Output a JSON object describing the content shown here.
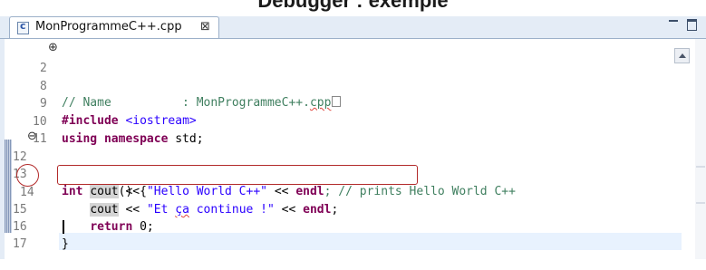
{
  "page": {
    "heading": "Debugger : exemple"
  },
  "tab": {
    "title": "MonProgrammeC++.cpp",
    "close_label": "⊠"
  },
  "window_controls": {
    "minimize": "minimize-icon",
    "maximize": "maximize-icon"
  },
  "editor": {
    "lines": [
      {
        "number": "2",
        "text": "// Name          : MonProgrammeC++.cpp"
      },
      {
        "number": "8",
        "text": ""
      },
      {
        "number": "9",
        "text": "#include <iostream>"
      },
      {
        "number": "10",
        "text": "using namespace std;"
      },
      {
        "number": "11",
        "text": ""
      },
      {
        "number": "12",
        "text": "int main() {"
      },
      {
        "number": "13",
        "text": "    cout << \"Hello World C++\" << endl; // prints Hello World C++"
      },
      {
        "number": "14",
        "text": "    cout << \"Et ça continue !\" << endl;"
      },
      {
        "number": "15",
        "text": "    return 0;"
      },
      {
        "number": "16",
        "text": "}"
      },
      {
        "number": "17",
        "text": ""
      }
    ],
    "tokens": {
      "l2_comment": "// Name          : MonProgrammeC++.",
      "l2_cpp": "cpp",
      "l9_kw": "#include",
      "l9_rest": " <iostream>",
      "l10_kw": "using namespace",
      "l10_rest": " std;",
      "l12_kw": "int",
      "l12_main": " main",
      "l12_rest": "() {",
      "indent": "    ",
      "cout": "cout",
      "shift": " << ",
      "l13_str": "\"Hello World C++\"",
      "endl": "endl",
      "l13_comment": "; // prints Hello World C++",
      "l14_str_a": "\"Et ",
      "l14_str_ca": "ça",
      "l14_str_b": " continue !\"",
      "semi": ";",
      "l15_kw": "return",
      "l15_rest": " 0;",
      "l16": "}"
    }
  },
  "colors": {
    "keyword": "#7f0055",
    "comment": "#3f7f5f",
    "string": "#2a00ff",
    "annotation": "#b22a2a"
  }
}
